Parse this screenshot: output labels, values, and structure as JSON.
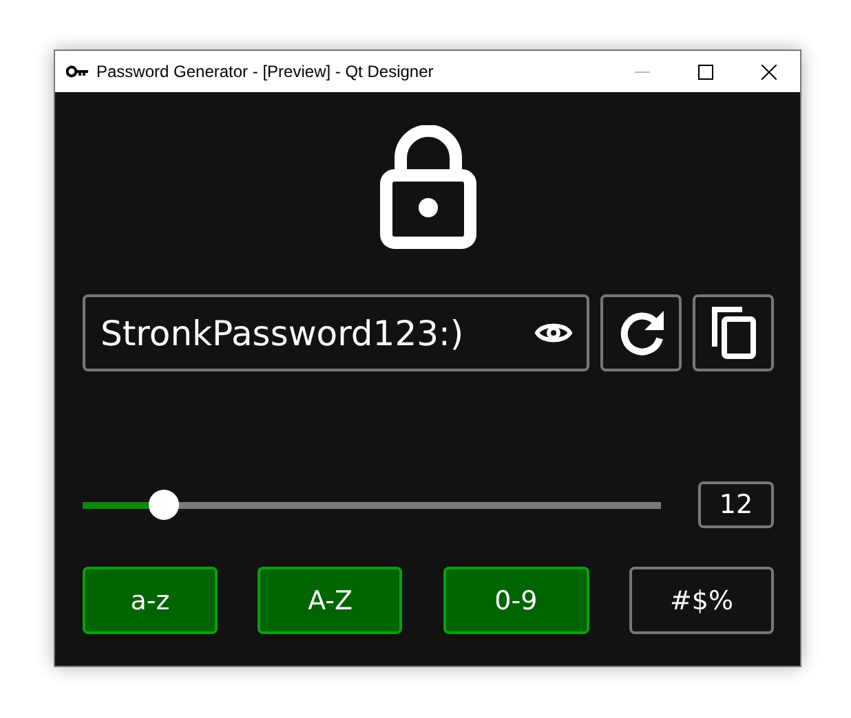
{
  "window": {
    "title": "Password Generator - [Preview] - Qt Designer"
  },
  "password": {
    "value": "StronkPassword123:)"
  },
  "length": {
    "level": 0.14,
    "value": "12"
  },
  "options": [
    {
      "label": "a-z",
      "checked": true
    },
    {
      "label": "A-Z",
      "checked": true
    },
    {
      "label": "0-9",
      "checked": true
    },
    {
      "label": "#$%",
      "checked": false
    }
  ]
}
